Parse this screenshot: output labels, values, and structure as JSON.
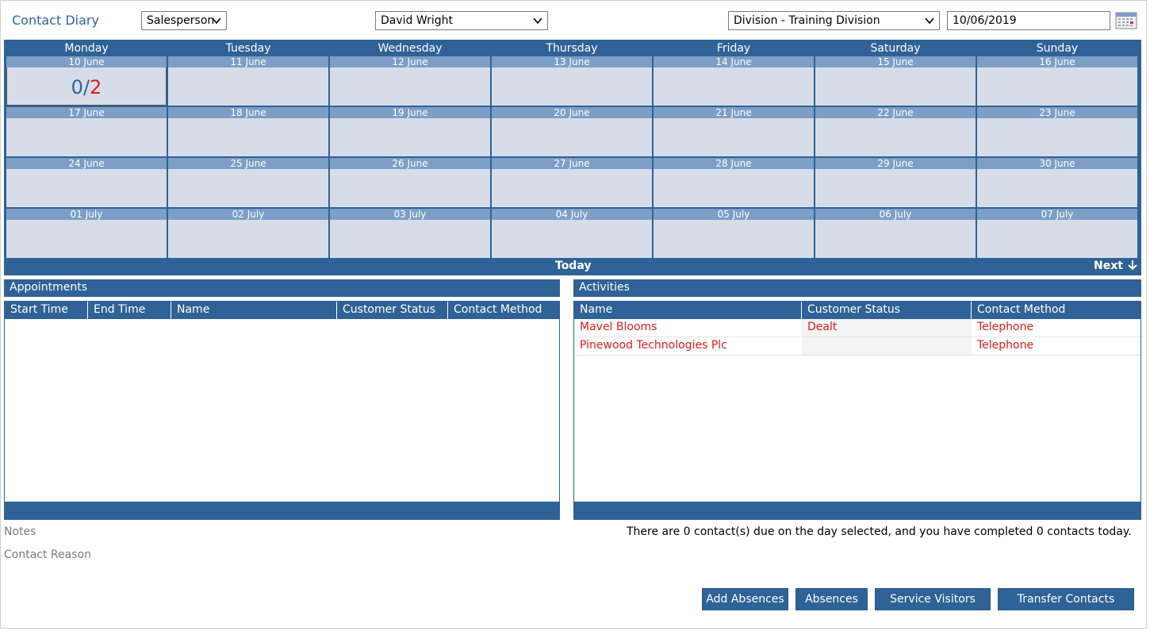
{
  "header": {
    "title": "Contact Diary",
    "filter_type": "Salesperson",
    "person": "David Wright",
    "division": "Division - Training Division",
    "date": "10/06/2019"
  },
  "calendar": {
    "days": [
      "Monday",
      "Tuesday",
      "Wednesday",
      "Thursday",
      "Friday",
      "Saturday",
      "Sunday"
    ],
    "weeks": [
      [
        "10 June",
        "11 June",
        "12 June",
        "13 June",
        "14 June",
        "15 June",
        "16 June"
      ],
      [
        "17 June",
        "18 June",
        "19 June",
        "20 June",
        "21 June",
        "22 June",
        "23 June"
      ],
      [
        "24 June",
        "25 June",
        "26 June",
        "27 June",
        "28 June",
        "29 June",
        "30 June"
      ],
      [
        "01 July",
        "02 July",
        "03 July",
        "04 July",
        "05 July",
        "06 July",
        "07 July"
      ]
    ],
    "selected_count_done": "0",
    "selected_count_sep": "/",
    "selected_count_total": "2",
    "today_label": "Today",
    "next_label": "Next"
  },
  "appointments": {
    "title": "Appointments",
    "columns": [
      "Start Time",
      "End Time",
      "Name",
      "Customer Status",
      "Contact Method"
    ],
    "rows": []
  },
  "activities": {
    "title": "Activities",
    "columns": [
      "Name",
      "Customer Status",
      "Contact Method"
    ],
    "rows": [
      [
        "Mavel Blooms",
        "Dealt",
        "Telephone"
      ],
      [
        "Pinewood Technologies Plc",
        "",
        "Telephone"
      ]
    ]
  },
  "notes_label": "Notes",
  "contact_reason_label": "Contact Reason",
  "status_message": "There are 0 contact(s) due on the day selected, and you have completed 0 contacts today.",
  "buttons": {
    "add_absences": "Add Absences",
    "absences": "Absences",
    "service_visitors": "Service Visitors",
    "transfer_contacts": "Transfer Contacts"
  },
  "colors": {
    "header_blue": "#2f6296",
    "day_label_blue": "#7d9ec6",
    "cell_bg": "#d6dde8",
    "alert_red": "#e11b1b"
  }
}
